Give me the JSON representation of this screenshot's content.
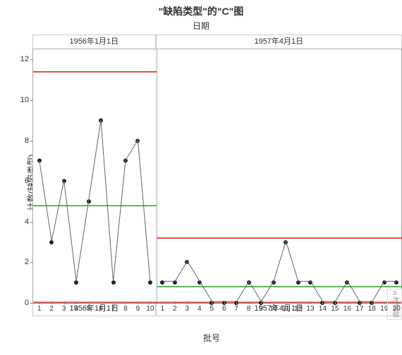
{
  "chart_data": {
    "type": "line",
    "title": "\"缺陷类型\"的\"C\"图",
    "subtitle": "日期",
    "xlabel": "批号",
    "ylabel": "计数(缺陷类型)",
    "ylim": [
      0,
      12.5
    ],
    "y_ticks": [
      0,
      2,
      4,
      6,
      8,
      10,
      12
    ],
    "panels": [
      {
        "label": "1956年1月1日",
        "x": [
          1,
          2,
          3,
          4,
          5,
          6,
          7,
          8,
          9,
          10
        ],
        "values": [
          7,
          3,
          6,
          1,
          5,
          9,
          1,
          7,
          8,
          1
        ],
        "ucl": 11.4,
        "cl": 4.8,
        "lcl": 0
      },
      {
        "label": "1957年4月1日",
        "x": [
          1,
          2,
          3,
          4,
          5,
          6,
          7,
          8,
          9,
          10,
          11,
          12,
          13,
          14,
          15,
          16,
          17,
          18,
          19,
          20
        ],
        "values": [
          1,
          1,
          2,
          1,
          0,
          0,
          0,
          1,
          0,
          1,
          3,
          1,
          1,
          0,
          0,
          1,
          0,
          0,
          1,
          1
        ],
        "ucl": 3.2,
        "cl": 0.8,
        "lcl": 0
      }
    ]
  },
  "side_tag": "n 次试验"
}
